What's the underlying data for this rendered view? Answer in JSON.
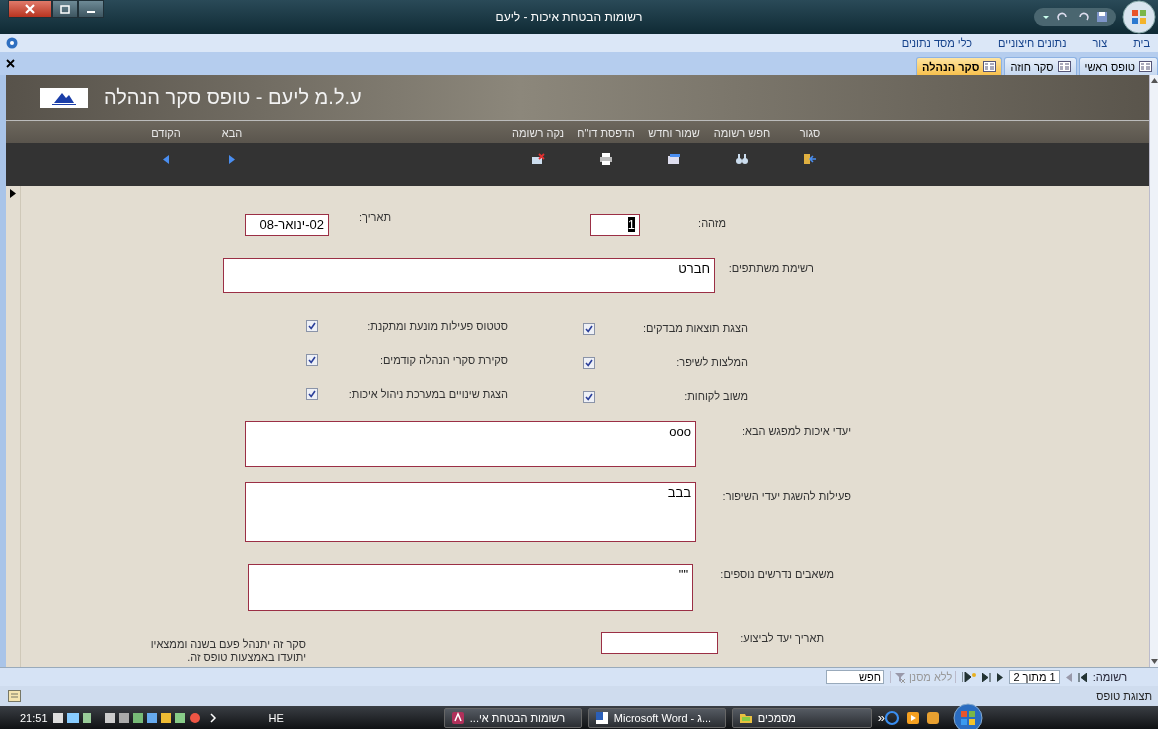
{
  "window": {
    "title": "רשומות הבטחת איכות - ליעם"
  },
  "ribbon_tabs": [
    {
      "label": "בית",
      "selected": false
    },
    {
      "label": "צור",
      "selected": false
    },
    {
      "label": "נתונים חיצוניים",
      "selected": false
    },
    {
      "label": "כלי מסד נתונים",
      "selected": false
    }
  ],
  "document_tabs": [
    {
      "label": "טופס ראשי",
      "selected": false
    },
    {
      "label": "סקר חוזה",
      "selected": false
    },
    {
      "label": "סקר הנהלה",
      "selected": true
    }
  ],
  "form_header": {
    "title": "ע.ל.מ ליעם - טופס סקר הנהלה"
  },
  "toolbar": [
    {
      "label": "סגור",
      "kind": "close"
    },
    {
      "label": "חפש רשומה",
      "kind": "find"
    },
    {
      "label": "שמור וחדש",
      "kind": "save"
    },
    {
      "label": "הדפסת דו\"ח",
      "kind": "print"
    },
    {
      "label": "נקה רשומה",
      "kind": "delete"
    }
  ],
  "record_nav": [
    {
      "label": "הבא",
      "kind": "next"
    },
    {
      "label": "הקודם",
      "kind": "previous"
    }
  ],
  "form": {
    "id_label": "מזהה:",
    "id_value": "1",
    "date_label": "תאריך:",
    "date_value": "02-ינואר-08",
    "participants_label": "רשימת משתתפים:",
    "participants_value": "חברט",
    "checkboxes_right": [
      {
        "label": "הצגת תוצאות מבדקים:",
        "checked": true
      },
      {
        "label": "המלצות לשיפר:",
        "checked": true
      },
      {
        "label": "משוב לקוחות:",
        "checked": true
      }
    ],
    "checkboxes_left": [
      {
        "label": "סטטוס פעילות מונעת ומתקנת:",
        "checked": true
      },
      {
        "label": "סקירת סקרי הנהלה קודמים:",
        "checked": true
      },
      {
        "label": "הצגת שינויים במערכת ניהול איכות:",
        "checked": true
      }
    ],
    "memos": [
      {
        "label": "יעדי איכות למפגש הבא:",
        "value": "ooo"
      },
      {
        "label": "פעילות להשגת יעדי השיפור:",
        "value": "בבב"
      },
      {
        "label": "משאבים נדרשים נוספים:",
        "value": "\"\""
      }
    ],
    "due_date_label": "תאריך יעד לביצוע:",
    "note_lines": [
      "סקר זה יתנהל פעם בשנה וממצאיו",
      "יתועדו באמצעות טופס זה."
    ]
  },
  "navigation_bar": {
    "label": "רשומה:",
    "position": "1 מתוך 2",
    "filter": "ללא מסנן",
    "search_placeholder": "חפש"
  },
  "status_bar": {
    "text": "תצוגת טופס"
  },
  "taskbar": {
    "clock": "21:51",
    "language": "HE",
    "tasks": [
      {
        "label": "מסמכים",
        "kind": "folder"
      },
      {
        "label": "Microsoft Word - ג...",
        "kind": "word"
      },
      {
        "label": "רשומות הבטחת אי...",
        "kind": "access"
      }
    ],
    "overflow": "»"
  }
}
